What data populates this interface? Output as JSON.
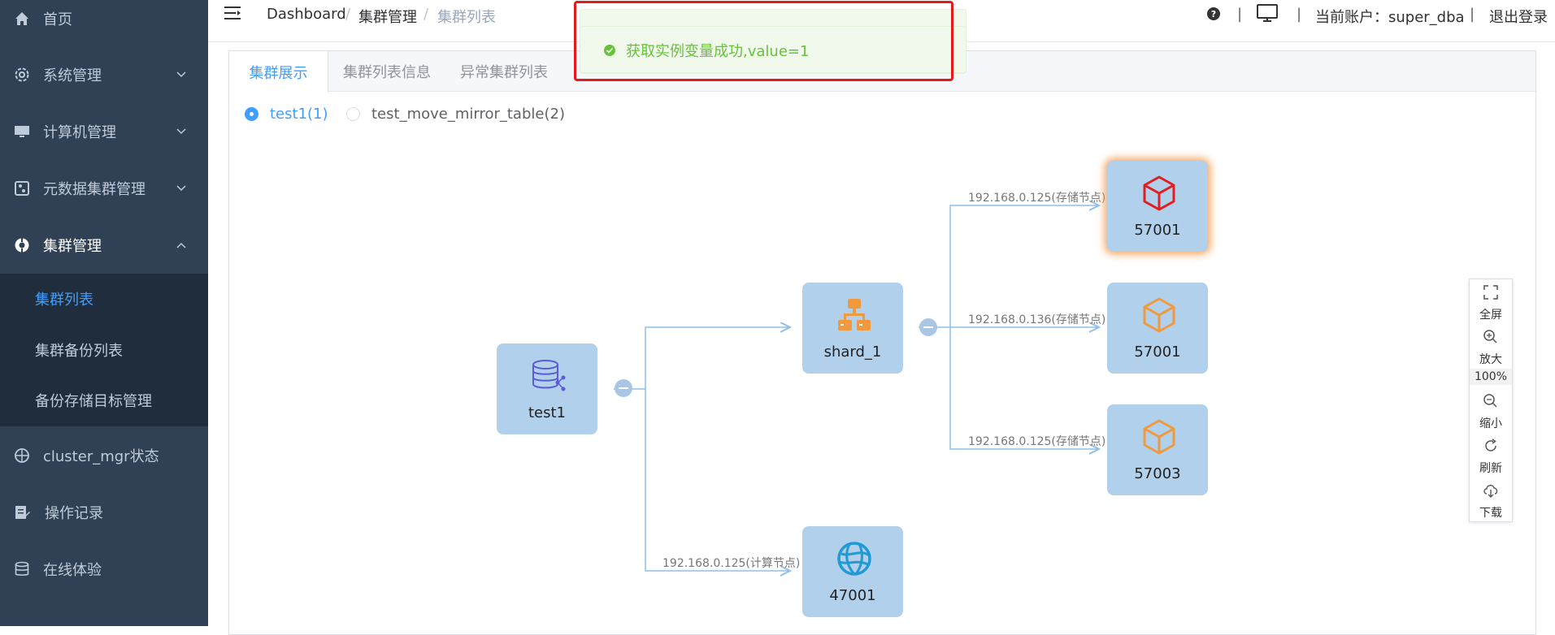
{
  "sidebar": {
    "items": [
      {
        "label": "首页",
        "icon": "home-icon"
      },
      {
        "label": "系统管理",
        "icon": "gear-icon"
      },
      {
        "label": "计算机管理",
        "icon": "monitor-icon"
      },
      {
        "label": "元数据集群管理",
        "icon": "sliders-icon"
      },
      {
        "label": "集群管理",
        "icon": "lifebuoy-icon"
      },
      {
        "label": "cluster_mgr状态",
        "icon": "crosshair-icon"
      },
      {
        "label": "操作记录",
        "icon": "edit-doc-icon"
      },
      {
        "label": "在线体验",
        "icon": "database-icon"
      }
    ],
    "submenu": [
      {
        "label": "集群列表",
        "active": true
      },
      {
        "label": "集群备份列表",
        "active": false
      },
      {
        "label": "备份存储目标管理",
        "active": false
      }
    ]
  },
  "header": {
    "breadcrumb": [
      "Dashboard",
      "集群管理",
      "集群列表"
    ],
    "account_label": "当前账户：super_dba",
    "logout": "退出登录"
  },
  "tabs": [
    "集群展示",
    "集群列表信息",
    "异常集群列表"
  ],
  "radios": [
    {
      "label": "test1(1)",
      "checked": true
    },
    {
      "label": "test_move_mirror_table(2)",
      "checked": false
    }
  ],
  "graph": {
    "nodes": [
      {
        "id": "root",
        "label": "test1",
        "icon": "database-share-icon"
      },
      {
        "id": "shard",
        "label": "shard_1",
        "icon": "sitemap-icon"
      },
      {
        "id": "s1",
        "label": "57001",
        "icon": "cube-icon",
        "color": "#e02020",
        "highlighted": true
      },
      {
        "id": "s2",
        "label": "57001",
        "icon": "cube-icon",
        "color": "#f0993e",
        "highlighted": false
      },
      {
        "id": "s3",
        "label": "57003",
        "icon": "cube-icon",
        "color": "#f0993e",
        "highlighted": false
      },
      {
        "id": "comp",
        "label": "47001",
        "icon": "globe-icon",
        "color": "#1f9ad6"
      }
    ],
    "edge_labels": [
      "192.168.0.125(存储节点)",
      "192.168.0.136(存储节点)",
      "192.168.0.125(存储节点)",
      "192.168.0.125(计算节点)"
    ]
  },
  "toolbox": {
    "fullscreen": "全屏",
    "zoom_in": "放大",
    "zoom_level": "100%",
    "zoom_out": "缩小",
    "refresh": "刷新",
    "download": "下载"
  },
  "toast": {
    "message": "获取实例变量成功,value=1",
    "type": "success",
    "color": "#67c23a"
  },
  "colors": {
    "sidebar_bg": "#304156",
    "submenu_bg": "#1f2d3d",
    "accent": "#409eff",
    "node_bg": "#b0d0ec"
  }
}
